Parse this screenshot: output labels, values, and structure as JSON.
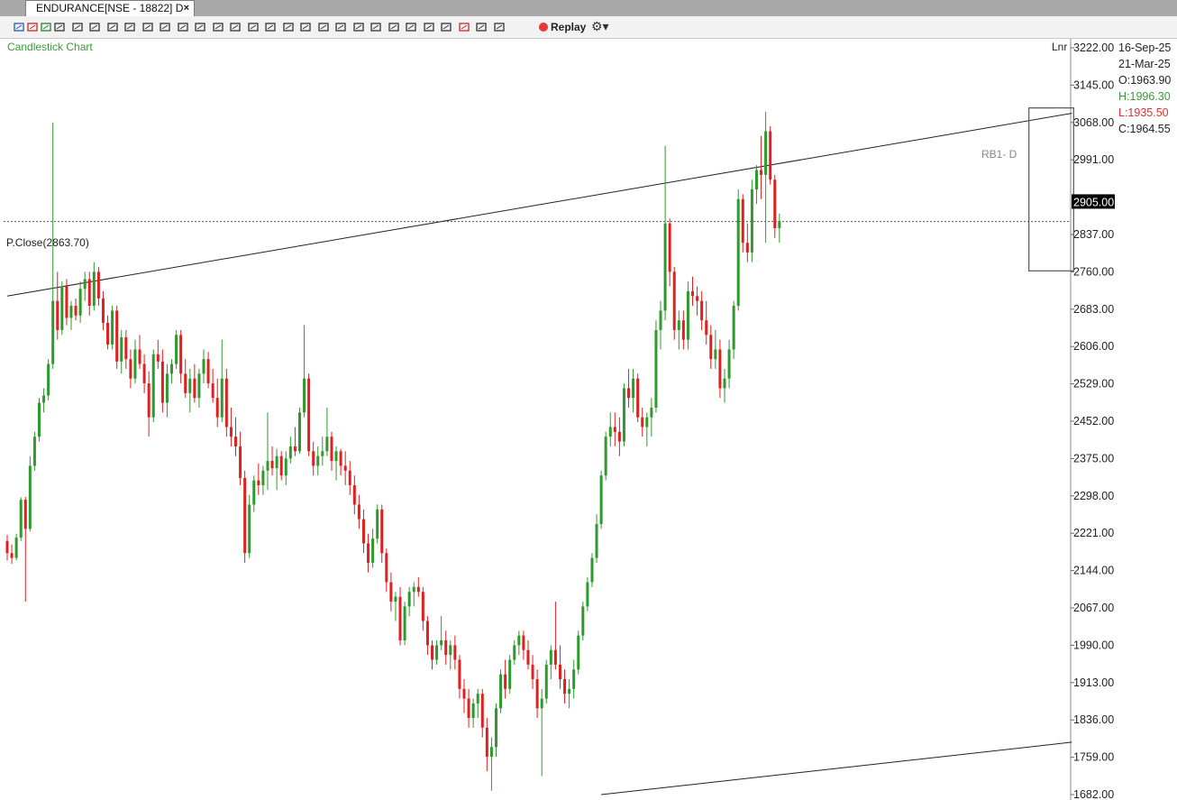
{
  "tab": {
    "title": "ENDURANCE[NSE - 18822] D",
    "close": "×"
  },
  "toolbar": {
    "icons": [
      "intraday-icon",
      "day-icon",
      "week-icon",
      "crosshair-icon",
      "pointer-icon",
      "bar-type-icon",
      "line-chart-icon",
      "candle-icon",
      "line-tool-icon",
      "scissors-icon",
      "pencil-icon",
      "ruler-icon",
      "line-icon",
      "horizontal-line-icon",
      "volume-icon",
      "cube-icon",
      "fib-icon",
      "parallel-lines-icon",
      "eraser-icon",
      "measure-icon",
      "shapes-icon",
      "template-icon",
      "save-icon",
      "link-icon",
      "calendar-icon",
      "star-icon",
      "alert-icon",
      "trash-icon",
      "performance-icon"
    ],
    "replay_label": "Replay",
    "settings_icon": "gear-icon"
  },
  "chart_label": "Candlestick Chart",
  "scale_mode": "Lnr",
  "info": {
    "date_from": "16-Sep-25",
    "date_to": "21-Mar-25",
    "open": "O:1963.90",
    "high": "H:1996.30",
    "low": "L:1935.50",
    "close": "C:1964.55"
  },
  "pclose_label": "P.Close(2863.70)",
  "last_price_label": "2905.00",
  "rb_label": "RB1- D",
  "colors": {
    "up": "#2e9a2e",
    "down": "#e02020",
    "pclose": "#555555",
    "last_price_bg": "#000000"
  },
  "chart_data": {
    "type": "candlestick",
    "title": "Candlestick Chart",
    "ylim": [
      1682,
      3222
    ],
    "yticks": [
      "3222.00",
      "3145.00",
      "3068.00",
      "2991.00",
      "2905.00",
      "2837.00",
      "2760.00",
      "2683.00",
      "2606.00",
      "2529.00",
      "2452.00",
      "2375.00",
      "2298.00",
      "2221.00",
      "2144.00",
      "2067.00",
      "1990.00",
      "1913.00",
      "1836.00",
      "1759.00",
      "1682.00"
    ],
    "pclose": 2863.7,
    "last_price": 2905.0,
    "trendlines": [
      {
        "from": [
          0,
          2710
        ],
        "to": [
          233,
          3087
        ]
      },
      {
        "from": [
          130,
          1682
        ],
        "to": [
          233,
          1790
        ]
      }
    ],
    "box": {
      "x0": 224,
      "x1": 233,
      "y_low": 2762,
      "y_high": 3098
    },
    "candles": [
      [
        2205,
        2218,
        2165,
        2180
      ],
      [
        2180,
        2198,
        2158,
        2170
      ],
      [
        2170,
        2220,
        2165,
        2212
      ],
      [
        2212,
        2295,
        2205,
        2290
      ],
      [
        2290,
        2296,
        2080,
        2230
      ],
      [
        2230,
        2380,
        2225,
        2360
      ],
      [
        2360,
        2430,
        2350,
        2420
      ],
      [
        2420,
        2500,
        2410,
        2490
      ],
      [
        2490,
        2520,
        2470,
        2505
      ],
      [
        2505,
        2580,
        2495,
        2570
      ],
      [
        2570,
        3068,
        2560,
        2700
      ],
      [
        2700,
        2760,
        2620,
        2640
      ],
      [
        2640,
        2740,
        2630,
        2730
      ],
      [
        2730,
        2745,
        2650,
        2665
      ],
      [
        2665,
        2700,
        2640,
        2690
      ],
      [
        2690,
        2705,
        2660,
        2670
      ],
      [
        2670,
        2740,
        2655,
        2725
      ],
      [
        2725,
        2760,
        2700,
        2745
      ],
      [
        2745,
        2760,
        2670,
        2690
      ],
      [
        2690,
        2780,
        2680,
        2760
      ],
      [
        2760,
        2770,
        2690,
        2705
      ],
      [
        2705,
        2720,
        2640,
        2655
      ],
      [
        2655,
        2670,
        2600,
        2610
      ],
      [
        2610,
        2690,
        2600,
        2680
      ],
      [
        2680,
        2690,
        2560,
        2575
      ],
      [
        2575,
        2640,
        2550,
        2625
      ],
      [
        2625,
        2640,
        2560,
        2580
      ],
      [
        2580,
        2600,
        2520,
        2540
      ],
      [
        2540,
        2620,
        2530,
        2600
      ],
      [
        2600,
        2630,
        2560,
        2570
      ],
      [
        2570,
        2590,
        2510,
        2530
      ],
      [
        2530,
        2555,
        2420,
        2460
      ],
      [
        2460,
        2600,
        2450,
        2590
      ],
      [
        2590,
        2620,
        2560,
        2575
      ],
      [
        2575,
        2600,
        2470,
        2490
      ],
      [
        2490,
        2570,
        2460,
        2550
      ],
      [
        2550,
        2580,
        2530,
        2570
      ],
      [
        2570,
        2640,
        2560,
        2630
      ],
      [
        2630,
        2640,
        2530,
        2550
      ],
      [
        2550,
        2580,
        2500,
        2510
      ],
      [
        2510,
        2560,
        2470,
        2540
      ],
      [
        2540,
        2570,
        2490,
        2500
      ],
      [
        2500,
        2560,
        2480,
        2550
      ],
      [
        2550,
        2600,
        2530,
        2580
      ],
      [
        2580,
        2595,
        2520,
        2530
      ],
      [
        2530,
        2560,
        2490,
        2500
      ],
      [
        2500,
        2540,
        2440,
        2460
      ],
      [
        2460,
        2620,
        2450,
        2540
      ],
      [
        2540,
        2560,
        2420,
        2440
      ],
      [
        2440,
        2480,
        2400,
        2420
      ],
      [
        2420,
        2460,
        2380,
        2400
      ],
      [
        2400,
        2430,
        2320,
        2335
      ],
      [
        2335,
        2350,
        2160,
        2180
      ],
      [
        2180,
        2300,
        2170,
        2280
      ],
      [
        2280,
        2340,
        2265,
        2330
      ],
      [
        2330,
        2365,
        2300,
        2320
      ],
      [
        2320,
        2360,
        2300,
        2350
      ],
      [
        2350,
        2470,
        2310,
        2370
      ],
      [
        2370,
        2400,
        2340,
        2355
      ],
      [
        2355,
        2395,
        2310,
        2380
      ],
      [
        2380,
        2390,
        2330,
        2340
      ],
      [
        2340,
        2390,
        2320,
        2375
      ],
      [
        2375,
        2420,
        2365,
        2400
      ],
      [
        2400,
        2440,
        2380,
        2390
      ],
      [
        2390,
        2480,
        2385,
        2470
      ],
      [
        2470,
        2650,
        2460,
        2540
      ],
      [
        2540,
        2550,
        2380,
        2390
      ],
      [
        2390,
        2410,
        2340,
        2360
      ],
      [
        2360,
        2400,
        2340,
        2380
      ],
      [
        2380,
        2420,
        2360,
        2390
      ],
      [
        2390,
        2480,
        2380,
        2420
      ],
      [
        2420,
        2430,
        2350,
        2370
      ],
      [
        2370,
        2400,
        2330,
        2390
      ],
      [
        2390,
        2395,
        2340,
        2360
      ],
      [
        2360,
        2390,
        2320,
        2350
      ],
      [
        2350,
        2370,
        2300,
        2320
      ],
      [
        2320,
        2340,
        2260,
        2280
      ],
      [
        2280,
        2300,
        2230,
        2250
      ],
      [
        2250,
        2270,
        2180,
        2200
      ],
      [
        2200,
        2220,
        2140,
        2160
      ],
      [
        2160,
        2230,
        2150,
        2210
      ],
      [
        2210,
        2280,
        2200,
        2270
      ],
      [
        2270,
        2280,
        2160,
        2180
      ],
      [
        2180,
        2190,
        2100,
        2120
      ],
      [
        2120,
        2140,
        2060,
        2080
      ],
      [
        2080,
        2100,
        2040,
        2090
      ],
      [
        2090,
        2110,
        1990,
        2000
      ],
      [
        2000,
        2080,
        1990,
        2070
      ],
      [
        2070,
        2110,
        2050,
        2100
      ],
      [
        2100,
        2120,
        2070,
        2110
      ],
      [
        2110,
        2130,
        2090,
        2100
      ],
      [
        2100,
        2110,
        2020,
        2040
      ],
      [
        2040,
        2050,
        1970,
        1990
      ],
      [
        1990,
        2000,
        1940,
        1960
      ],
      [
        1960,
        2000,
        1950,
        1990
      ],
      [
        1990,
        2050,
        1980,
        2000
      ],
      [
        2000,
        2020,
        1950,
        1970
      ],
      [
        1970,
        2000,
        1940,
        1990
      ],
      [
        1990,
        2010,
        1940,
        1960
      ],
      [
        1960,
        1970,
        1880,
        1900
      ],
      [
        1900,
        1920,
        1850,
        1880
      ],
      [
        1880,
        1900,
        1820,
        1840
      ],
      [
        1840,
        1880,
        1820,
        1870
      ],
      [
        1870,
        1900,
        1840,
        1890
      ],
      [
        1890,
        1900,
        1800,
        1820
      ],
      [
        1820,
        1840,
        1730,
        1760
      ],
      [
        1760,
        1800,
        1690,
        1780
      ],
      [
        1780,
        1870,
        1760,
        1860
      ],
      [
        1860,
        1940,
        1850,
        1930
      ],
      [
        1930,
        1960,
        1880,
        1900
      ],
      [
        1900,
        1970,
        1890,
        1960
      ],
      [
        1960,
        2000,
        1950,
        1990
      ],
      [
        1990,
        2020,
        1970,
        2010
      ],
      [
        2010,
        2020,
        1960,
        1980
      ],
      [
        1980,
        2000,
        1940,
        1950
      ],
      [
        1950,
        1970,
        1900,
        1920
      ],
      [
        1920,
        1940,
        1840,
        1860
      ],
      [
        1860,
        1900,
        1720,
        1880
      ],
      [
        1880,
        1960,
        1870,
        1950
      ],
      [
        1950,
        1990,
        1920,
        1980
      ],
      [
        1980,
        2080,
        1940,
        1950
      ],
      [
        1950,
        1990,
        1900,
        1920
      ],
      [
        1920,
        1940,
        1870,
        1890
      ],
      [
        1890,
        1920,
        1860,
        1900
      ],
      [
        1900,
        1960,
        1880,
        1940
      ],
      [
        1940,
        2020,
        1930,
        2010
      ],
      [
        2010,
        2080,
        2000,
        2070
      ],
      [
        2070,
        2130,
        2060,
        2120
      ],
      [
        2120,
        2180,
        2110,
        2170
      ],
      [
        2170,
        2260,
        2160,
        2240
      ],
      [
        2240,
        2350,
        2230,
        2340
      ],
      [
        2340,
        2430,
        2330,
        2420
      ],
      [
        2420,
        2470,
        2400,
        2440
      ],
      [
        2440,
        2470,
        2400,
        2430
      ],
      [
        2430,
        2460,
        2380,
        2410
      ],
      [
        2410,
        2530,
        2400,
        2520
      ],
      [
        2520,
        2560,
        2480,
        2500
      ],
      [
        2500,
        2560,
        2470,
        2540
      ],
      [
        2540,
        2550,
        2450,
        2460
      ],
      [
        2460,
        2480,
        2420,
        2440
      ],
      [
        2440,
        2470,
        2400,
        2460
      ],
      [
        2460,
        2500,
        2420,
        2480
      ],
      [
        2480,
        2660,
        2470,
        2640
      ],
      [
        2640,
        2700,
        2600,
        2680
      ],
      [
        2680,
        3020,
        2660,
        2860
      ],
      [
        2860,
        2870,
        2730,
        2760
      ],
      [
        2760,
        2770,
        2620,
        2640
      ],
      [
        2640,
        2680,
        2600,
        2660
      ],
      [
        2660,
        2680,
        2600,
        2620
      ],
      [
        2620,
        2740,
        2600,
        2720
      ],
      [
        2720,
        2750,
        2690,
        2710
      ],
      [
        2710,
        2730,
        2670,
        2700
      ],
      [
        2700,
        2720,
        2640,
        2660
      ],
      [
        2660,
        2700,
        2610,
        2630
      ],
      [
        2630,
        2650,
        2560,
        2580
      ],
      [
        2580,
        2640,
        2560,
        2600
      ],
      [
        2600,
        2620,
        2500,
        2520
      ],
      [
        2520,
        2560,
        2490,
        2540
      ],
      [
        2540,
        2620,
        2520,
        2600
      ],
      [
        2600,
        2700,
        2580,
        2690
      ],
      [
        2690,
        2930,
        2680,
        2910
      ],
      [
        2910,
        2920,
        2800,
        2820
      ],
      [
        2820,
        2860,
        2780,
        2800
      ],
      [
        2800,
        2950,
        2780,
        2930
      ],
      [
        2930,
        2980,
        2900,
        2970
      ],
      [
        2970,
        3040,
        2910,
        2960
      ],
      [
        2960,
        3090,
        2820,
        3050
      ],
      [
        3050,
        3060,
        2940,
        2950
      ],
      [
        2950,
        2960,
        2830,
        2850
      ],
      [
        2850,
        2880,
        2820,
        2865
      ]
    ]
  }
}
